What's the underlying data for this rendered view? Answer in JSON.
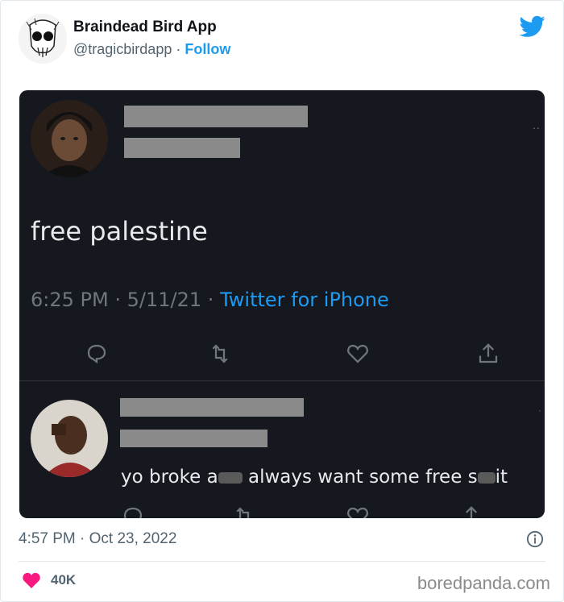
{
  "header": {
    "name": "Braindead Bird App",
    "handle": "@tragicbirdapp",
    "separator": "·",
    "follow_label": "Follow"
  },
  "embedded": {
    "tweet_text": "free palestine",
    "time": "6:25 PM",
    "date": "5/11/21",
    "dot": "·",
    "source": "Twitter for iPhone",
    "reply_part1": "yo broke a",
    "reply_part2": " always want some free s",
    "reply_part3": "it"
  },
  "footer": {
    "timestamp": "4:57 PM · Oct 23, 2022",
    "likes": "40K",
    "watermark": "boredpanda.com"
  },
  "colors": {
    "twitter_blue": "#1d9bf0",
    "like_pink": "#f91880",
    "dark_bg": "#15181f"
  }
}
